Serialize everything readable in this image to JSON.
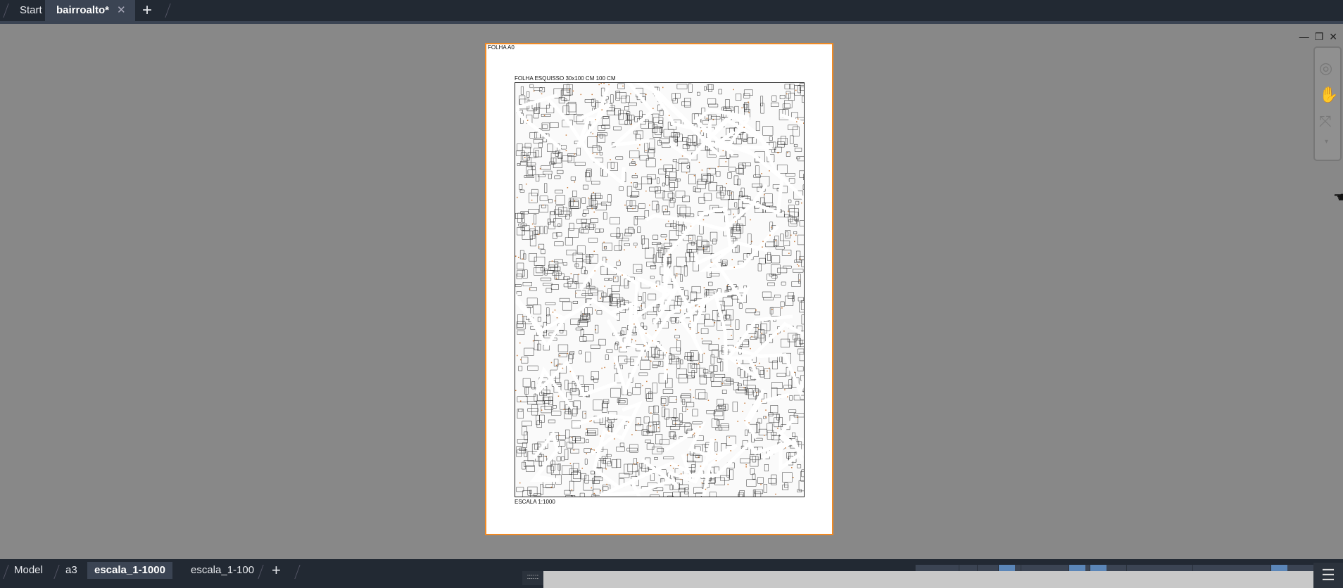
{
  "top_tabs": [
    {
      "label": "Start"
    },
    {
      "label": "bairroalto*",
      "active": true
    }
  ],
  "close_glyph": "✕",
  "add_glyph": "+",
  "paper": {
    "title_top": "FOLHA A0",
    "map_title": "FOLHA ESQUISSO 30x100 CM  100 CM",
    "scale_label": "ESCALA 1:1000"
  },
  "layout_tabs": [
    {
      "label": "Model"
    },
    {
      "label": "a3"
    },
    {
      "label": "escala_1-1000",
      "active": true
    },
    {
      "label": "escala_1-100"
    }
  ],
  "window_controls": {
    "minimize": "—",
    "restore": "❐",
    "close": "✕"
  },
  "navbar_icons": [
    "steering-wheel-2d-icon",
    "pan-hand-icon",
    "zoom-extents-icon"
  ],
  "cmd_grip": "::::::",
  "menu_glyph": "☰",
  "colors": {
    "accent": "#f08a24",
    "toolbar": "#222933",
    "active_tab": "#3b4453"
  }
}
